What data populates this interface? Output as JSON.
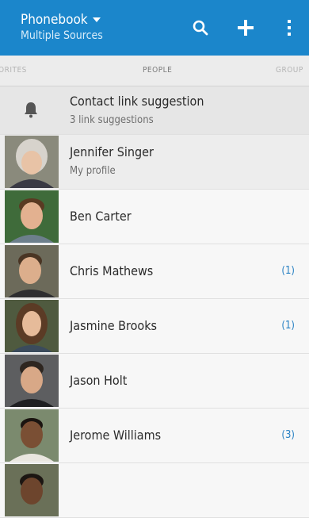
{
  "header": {
    "title": "Phonebook",
    "subtitle": "Multiple Sources",
    "icons": [
      "search-icon",
      "add-icon",
      "more-vert-icon"
    ],
    "color": "#1b86cb"
  },
  "tabs": {
    "favorites": "ORITES",
    "people": "PEOPLE",
    "groups": "GROUP"
  },
  "suggestion": {
    "title": "Contact link suggestion",
    "subtitle": "3 link suggestions",
    "icon": "bell-icon"
  },
  "contacts": [
    {
      "name": "Jennifer Singer",
      "subtitle": "My profile",
      "badge": ""
    },
    {
      "name": "Ben Carter",
      "subtitle": "",
      "badge": ""
    },
    {
      "name": "Chris Mathews",
      "subtitle": "",
      "badge": "(1)"
    },
    {
      "name": "Jasmine Brooks",
      "subtitle": "",
      "badge": "(1)"
    },
    {
      "name": "Jason Holt",
      "subtitle": "",
      "badge": ""
    },
    {
      "name": "Jerome Williams",
      "subtitle": "",
      "badge": "(3)"
    }
  ]
}
